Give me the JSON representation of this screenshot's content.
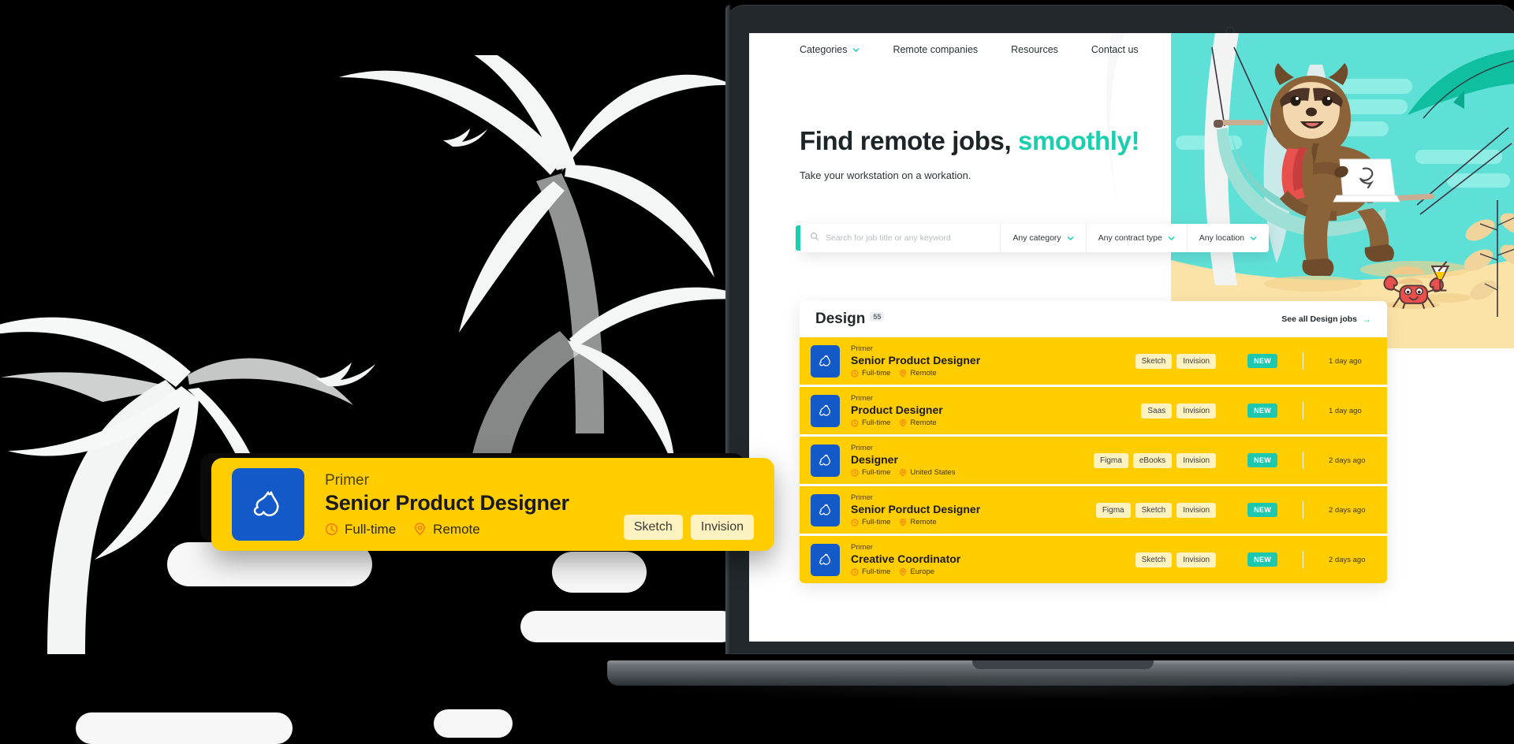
{
  "nav": {
    "items": [
      {
        "label": "Categories",
        "has_chevron": true,
        "icon": "chevron-down-icon"
      },
      {
        "label": "Remote companies",
        "has_chevron": false
      },
      {
        "label": "Resources",
        "has_chevron": false
      },
      {
        "label": "Contact us",
        "has_chevron": false
      }
    ]
  },
  "hero": {
    "headline_main": "Find remote jobs,",
    "headline_accent": "smoothly!",
    "subline": "Take your workstation on a workation.",
    "illustration": "sloth-in-hammock-with-laptop-on-beach"
  },
  "search": {
    "placeholder": "Search for job title or any keyword",
    "value": "",
    "search_icon": "search-icon",
    "filters": [
      {
        "label": "Any category",
        "icon": "chevron-down-icon"
      },
      {
        "label": "Any contract type",
        "icon": "chevron-down-icon"
      },
      {
        "label": "Any location",
        "icon": "chevron-down-icon"
      }
    ]
  },
  "jobs_section": {
    "title": "Design",
    "count": "55",
    "see_all_label": "See all Design jobs",
    "see_all_arrow": "→",
    "rows": [
      {
        "company": "Primer",
        "title": "Senior Product Designer",
        "contract": "Full-time",
        "location": "Remote",
        "tags": [
          "Sketch",
          "Invision"
        ],
        "badge": "NEW",
        "posted": "1 day ago"
      },
      {
        "company": "Primer",
        "title": "Product Designer",
        "contract": "Full-time",
        "location": "Remote",
        "tags": [
          "Saas",
          "Invision"
        ],
        "badge": "NEW",
        "posted": "1 day ago"
      },
      {
        "company": "Primer",
        "title": "Designer",
        "contract": "Full-time",
        "location": "United States",
        "tags": [
          "Figma",
          "eBooks",
          "Invision"
        ],
        "badge": "NEW",
        "posted": "2 days ago"
      },
      {
        "company": "Primer",
        "title": "Senior Porduct Designer",
        "contract": "Full-time",
        "location": "Remote",
        "tags": [
          "Figma",
          "Sketch",
          "Invision"
        ],
        "badge": "NEW",
        "posted": "2 days ago"
      },
      {
        "company": "Primer",
        "title": "Creative Coordinator",
        "contract": "Full-time",
        "location": "Europe",
        "tags": [
          "Sketch",
          "Invision"
        ],
        "badge": "NEW",
        "posted": "2 days ago"
      }
    ]
  },
  "callout": {
    "company": "Primer",
    "title": "Senior Product Designer",
    "contract": "Full-time",
    "location": "Remote",
    "tags": [
      "Sketch",
      "Invision"
    ],
    "clock_icon": "clock-icon",
    "pin_icon": "map-pin-icon",
    "logo_icon": "primer-leaf-logo-icon"
  },
  "colors": {
    "brand_yellow": "#FFCD00",
    "brand_teal": "#19CFAE",
    "logo_blue": "#1459C8",
    "tag_bg": "#FDF2C0",
    "sky": "#5FE0D6",
    "sand": "#FBE3A8",
    "dark": "#22292D"
  }
}
